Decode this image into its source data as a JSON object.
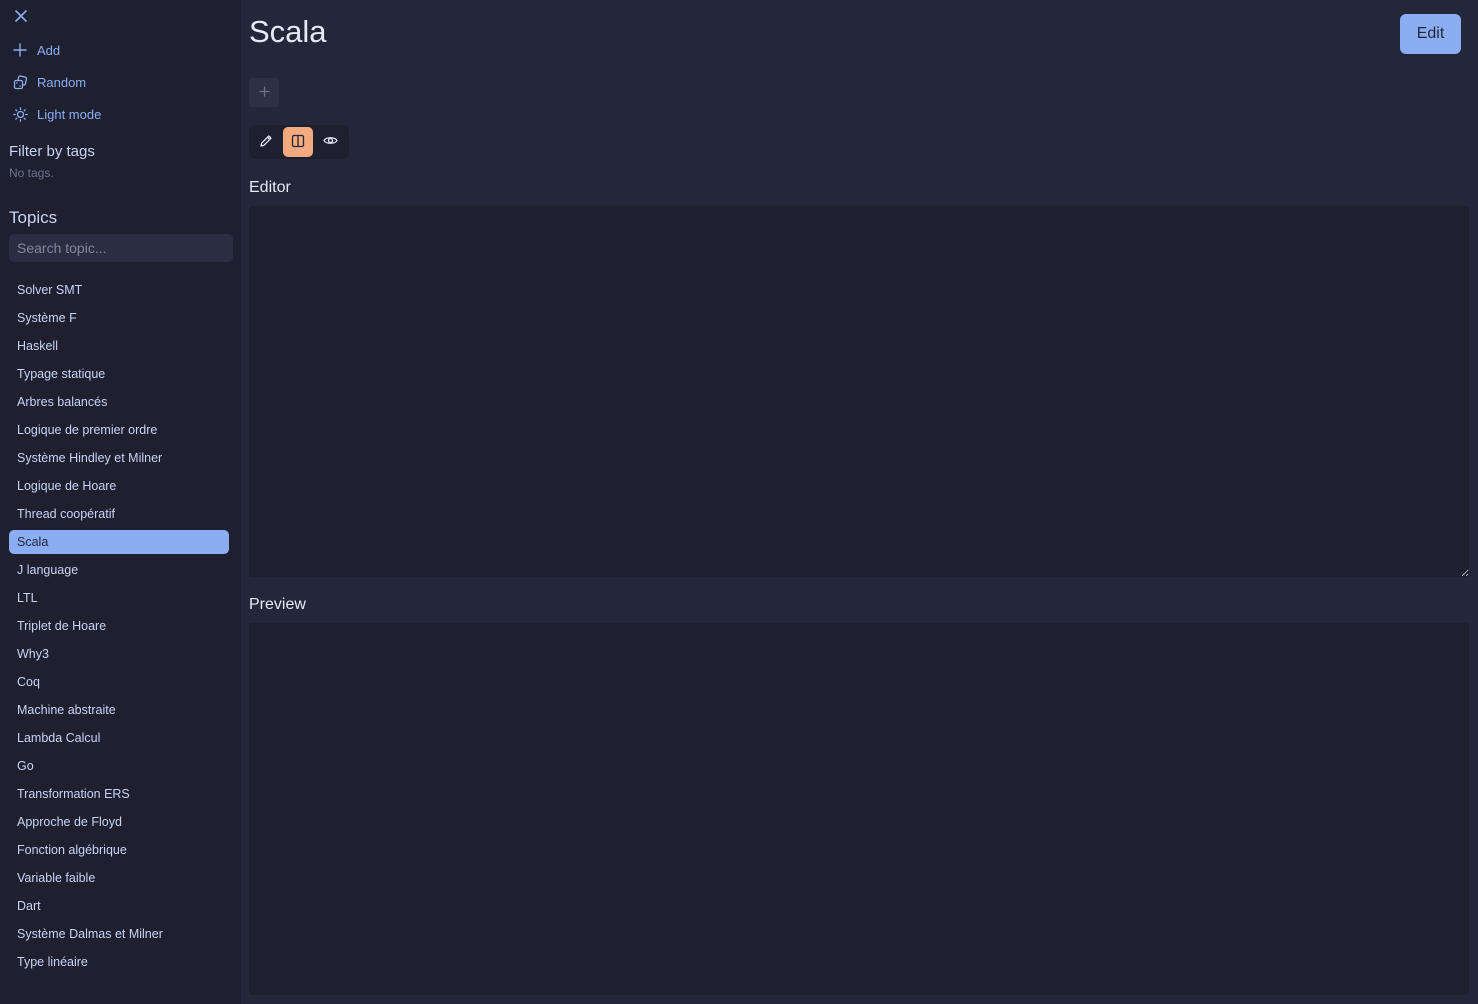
{
  "sidebar": {
    "close_label": "Close",
    "actions": {
      "add": "Add",
      "random": "Random",
      "light_mode": "Light mode"
    },
    "filter_title": "Filter by tags",
    "filter_empty": "No tags.",
    "topics_title": "Topics",
    "search_placeholder": "Search topic...",
    "search_value": "",
    "topics": [
      "Solver SMT",
      "Système F",
      "Haskell",
      "Typage statique",
      "Arbres balancés",
      "Logique de premier ordre",
      "Système Hindley et Milner",
      "Logique de Hoare",
      "Thread coopératif",
      "Scala",
      "J language",
      "LTL",
      "Triplet de Hoare",
      "Why3",
      "Coq",
      "Machine abstraite",
      "Lambda Calcul",
      "Go",
      "Transformation ERS",
      "Approche de Floyd",
      "Fonction algébrique",
      "Variable faible",
      "Dart",
      "Système Dalmas et Milner",
      "Type linéaire"
    ],
    "active_topic": "Scala"
  },
  "main": {
    "title": "Scala",
    "edit_label": "Edit",
    "view_mode": "split",
    "editor_label": "Editor",
    "editor_content": "",
    "preview_label": "Preview",
    "preview_content": ""
  },
  "colors": {
    "background": "#24273a",
    "sidebar": "#1e2030",
    "accent": "#8aadf4",
    "active_mode": "#f5a97f",
    "text": "#cad3f5",
    "muted": "#6e738d"
  },
  "icons": {
    "close": "close-icon",
    "add": "plus-icon",
    "random": "dice-icon",
    "light_mode": "sun-icon",
    "add_tag": "plus-icon",
    "mode_edit": "pencil-icon",
    "mode_split": "columns-icon",
    "mode_preview": "eye-icon"
  }
}
